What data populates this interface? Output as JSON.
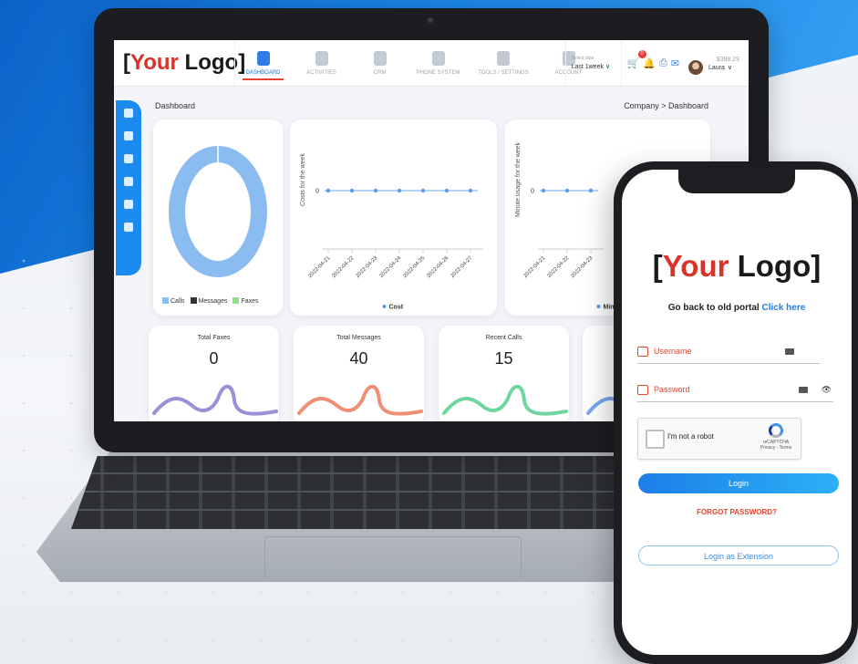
{
  "colors": {
    "accent": "#1c8bf0",
    "brand_red": "#d8332a",
    "faxes_green": "#8fe08a",
    "messages_dark": "#333333",
    "calls_blue": "#8bbcf0"
  },
  "app": {
    "logo": {
      "open": "[",
      "your": "Your",
      "rest": " Logo",
      "close": "]"
    },
    "nav": [
      {
        "label": "DASHBOARD",
        "icon": "dashboard-icon",
        "active": true
      },
      {
        "label": "ACTIVITIES",
        "icon": "activities-icon"
      },
      {
        "label": "CRM",
        "icon": "crm-icon"
      },
      {
        "label": "PHONE SYSTEM",
        "icon": "phone-system-icon"
      },
      {
        "label": "TOOLS / SETTINGS",
        "icon": "tools-icon"
      },
      {
        "label": "ACCOUNT",
        "icon": "account-icon"
      }
    ],
    "date_select": {
      "label": "Select date",
      "value": "Last 1week"
    },
    "notifications_count": "0",
    "balance": "$388.29",
    "user_name": "Laura",
    "breadcrumb_title": "Dashboard",
    "breadcrumb_path": "Company > Dashboard",
    "sidebar_icons": [
      "menu-icon",
      "org-icon",
      "phone-icon",
      "dialpad-icon",
      "wallet-icon",
      "team-icon"
    ]
  },
  "donut": {
    "legend": [
      "Calls",
      "Messages",
      "Faxes"
    ]
  },
  "chart_data": [
    {
      "type": "line",
      "ylabel": "Costs for the week",
      "x": [
        "2022-04-21",
        "2022-04-22",
        "2022-04-23",
        "2022-04-24",
        "2022-04-25",
        "2022-04-26",
        "2022-04-27"
      ],
      "series": [
        {
          "name": "Cost",
          "values": [
            0,
            0,
            0,
            0,
            0,
            0,
            0
          ]
        }
      ],
      "yticks": [
        "0"
      ]
    },
    {
      "type": "line",
      "ylabel": "Minute usage for the week",
      "x": [
        "2022-04-21",
        "2022-04-22",
        "2022-04-23"
      ],
      "series": [
        {
          "name": "Minu",
          "values": [
            0,
            0,
            0
          ]
        }
      ],
      "yticks": [
        "0"
      ]
    }
  ],
  "stats": [
    {
      "title": "Total Faxes",
      "value": "0",
      "color": "#9b8fd6"
    },
    {
      "title": "Total Messages",
      "value": "40",
      "color": "#f08f74"
    },
    {
      "title": "Recent Calls",
      "value": "15",
      "color": "#6fd6a0"
    }
  ],
  "phone": {
    "logo": {
      "open": "[",
      "your": "Your",
      "rest": " Logo",
      "close": "]"
    },
    "old_portal_text": "Go back to old portal",
    "old_portal_link": "Click here",
    "username_placeholder": "Username",
    "password_placeholder": "Password",
    "captcha_text": "I'm not a robot",
    "captcha_brand": "reCAPTCHA",
    "captcha_terms": "Privacy - Terms",
    "login_label": "Login",
    "forgot_label": "FORGOT PASSWORD?",
    "extension_label": "Login as Extension"
  }
}
